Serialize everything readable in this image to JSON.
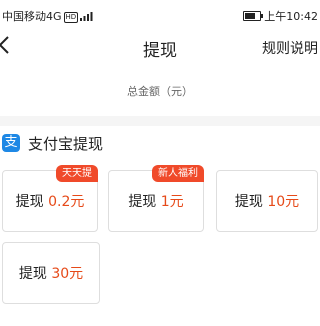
{
  "statusbar": {
    "carrier": "中国移动4G",
    "hd": "HD",
    "time": "上午10:42"
  },
  "navbar": {
    "back_label": "<",
    "title": "提现",
    "rules_label": "规则说明"
  },
  "total": {
    "label": "总金额（元）"
  },
  "alipay": {
    "icon_label": "支",
    "title": "支付宝提现",
    "options": [
      {
        "prefix": "提现",
        "amount": "0.2元",
        "tag": "天天提"
      },
      {
        "prefix": "提现",
        "amount": "1元",
        "tag": "新人福利"
      },
      {
        "prefix": "提现",
        "amount": "10元",
        "tag": ""
      },
      {
        "prefix": "提现",
        "amount": "30元",
        "tag": ""
      }
    ]
  },
  "colors": {
    "accent": "#e64a19",
    "tag": "#f04a2a",
    "alipay": "#1e88e5"
  }
}
